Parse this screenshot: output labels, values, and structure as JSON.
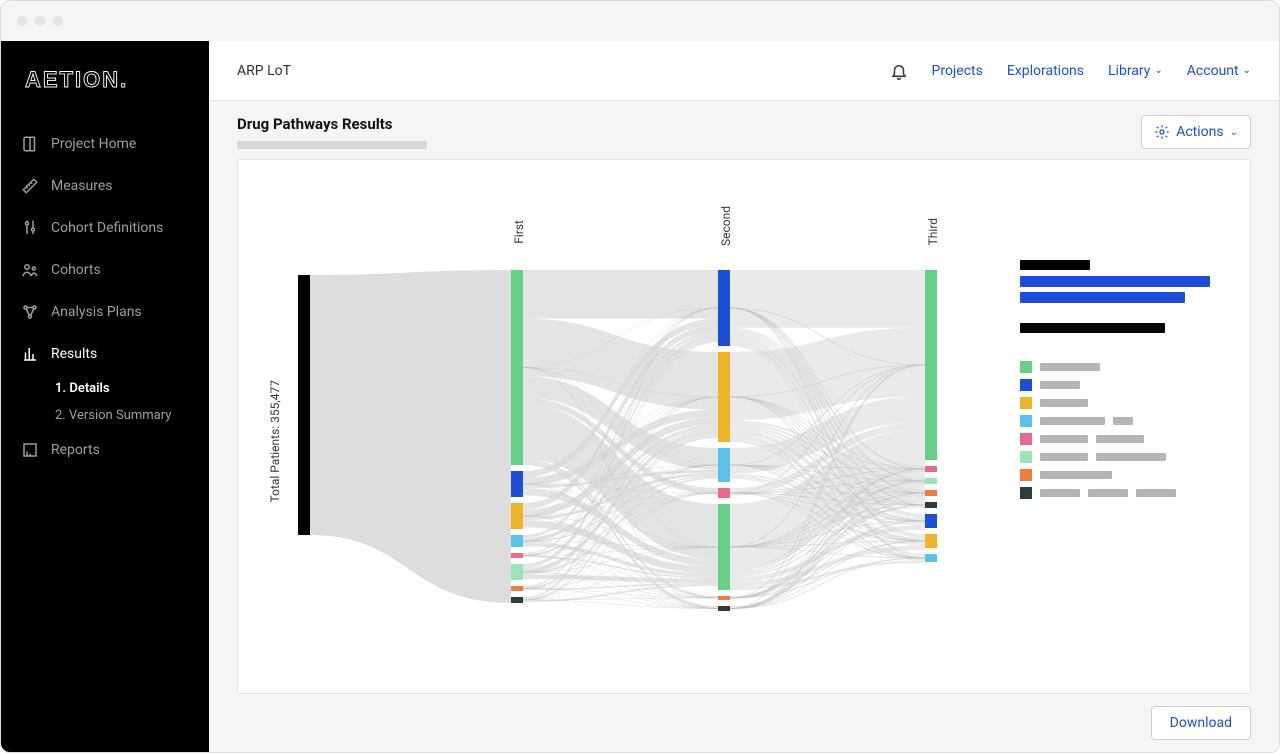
{
  "logo": "AETION.",
  "nav": {
    "items": [
      {
        "label": "Project Home"
      },
      {
        "label": "Measures"
      },
      {
        "label": "Cohort Definitions"
      },
      {
        "label": "Cohorts"
      },
      {
        "label": "Analysis Plans"
      },
      {
        "label": "Results"
      },
      {
        "label": "Reports"
      }
    ],
    "results_sub": [
      {
        "label": "1.  Details"
      },
      {
        "label": "2.  Version Summary"
      }
    ]
  },
  "topbar": {
    "breadcrumb": "ARP LoT",
    "links": {
      "projects": "Projects",
      "explorations": "Explorations",
      "library": "Library",
      "account": "Account"
    }
  },
  "page": {
    "title": "Drug Pathways Results",
    "actions": "Actions",
    "download": "Download"
  },
  "chart_data": {
    "type": "sankey",
    "total_label": "Total Patients: 355,477",
    "stage_labels": [
      "First",
      "Second",
      "Third"
    ],
    "colors": {
      "green": "#68cf89",
      "blue": "#1d4ed8",
      "yellow": "#f0b429",
      "lightblue": "#5bc0eb",
      "pink": "#e86a8c",
      "lightgreen": "#9ce3b6",
      "orange": "#f07b3f",
      "dark": "#2c3e3a"
    },
    "nodes": {
      "start": [
        {
          "color": "#000",
          "size": 260
        }
      ],
      "first": [
        {
          "color": "green",
          "size": 195
        },
        {
          "color": "blue",
          "size": 26
        },
        {
          "color": "yellow",
          "size": 26
        },
        {
          "color": "lightblue",
          "size": 12
        },
        {
          "color": "pink",
          "size": 5
        },
        {
          "color": "lightgreen",
          "size": 16
        },
        {
          "color": "orange",
          "size": 5
        },
        {
          "color": "dark",
          "size": 6
        }
      ],
      "second": [
        {
          "color": "blue",
          "size": 76
        },
        {
          "color": "yellow",
          "size": 90
        },
        {
          "color": "lightblue",
          "size": 34
        },
        {
          "color": "pink",
          "size": 10
        },
        {
          "color": "green",
          "size": 86
        },
        {
          "color": "orange",
          "size": 4
        },
        {
          "color": "dark",
          "size": 5
        }
      ],
      "third": [
        {
          "color": "green",
          "size": 190
        },
        {
          "color": "pink",
          "size": 6
        },
        {
          "color": "lightgreen",
          "size": 6
        },
        {
          "color": "orange",
          "size": 6
        },
        {
          "color": "dark",
          "size": 6
        },
        {
          "color": "blue",
          "size": 14
        },
        {
          "color": "yellow",
          "size": 14
        },
        {
          "color": "lightblue",
          "size": 8
        }
      ]
    },
    "legend_colors": [
      "green",
      "blue",
      "yellow",
      "lightblue",
      "pink",
      "lightgreen",
      "orange",
      "dark"
    ]
  }
}
